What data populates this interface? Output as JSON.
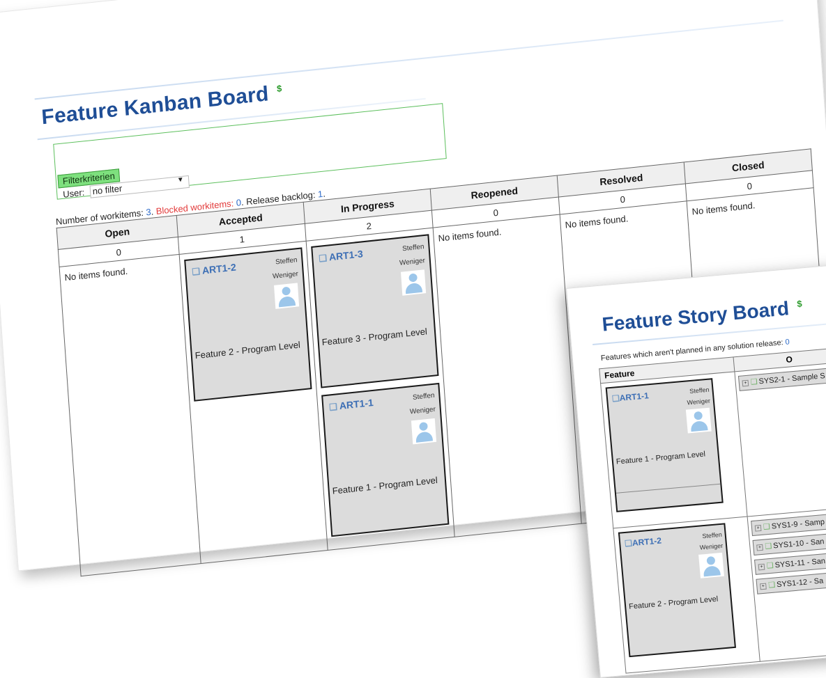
{
  "kanban": {
    "title": "Feature Kanban Board",
    "refresh_icon": "refresh-icon",
    "filter": {
      "legend": "Filterkriterien",
      "user_label": "User:",
      "user_value": "no filter"
    },
    "summary": {
      "workitems_label": "Number of workitems:",
      "workitems_count": "3",
      "blocked_label": "Blocked workitems:",
      "blocked_count": "0",
      "backlog_label": "Release backlog:",
      "backlog_count": "1"
    },
    "columns": [
      {
        "name": "Open",
        "count": "0",
        "empty_text": "No items found."
      },
      {
        "name": "Accepted",
        "count": "1"
      },
      {
        "name": "In Progress",
        "count": "2"
      },
      {
        "name": "Reopened",
        "count": "0",
        "empty_text": "No items found."
      },
      {
        "name": "Resolved",
        "count": "0",
        "empty_text": "No items found."
      },
      {
        "name": "Closed",
        "count": "0",
        "empty_text": "No items found."
      }
    ],
    "cards": [
      {
        "id": "ART1-2",
        "owner_first": "Steffen",
        "owner_last": "Weniger",
        "title": "Feature 2 - Program Level"
      },
      {
        "id": "ART1-3",
        "owner_first": "Steffen",
        "owner_last": "Weniger",
        "title": "Feature 3 - Program Level"
      },
      {
        "id": "ART1-1",
        "owner_first": "Steffen",
        "owner_last": "Weniger",
        "title": "Feature 1 - Program Level"
      }
    ]
  },
  "story": {
    "title": "Feature Story Board",
    "summary_label": "Features which aren't planned in any solution release:",
    "summary_count": "0",
    "feature_header": "Feature",
    "open_header": "O",
    "rows": [
      {
        "card": {
          "id": "ART1-1",
          "owner_first": "Steffen",
          "owner_last": "Weniger",
          "title": "Feature 1 - Program Level"
        },
        "stories": [
          "SYS2-1 - Sample S"
        ]
      },
      {
        "card": {
          "id": "ART1-2",
          "owner_first": "Steffen",
          "owner_last": "Weniger",
          "title": "Feature 2 - Program Level"
        },
        "stories": [
          "SYS1-9 - Samp",
          "SYS1-10 - San",
          "SYS1-11 - San",
          "SYS1-12 - Sa"
        ]
      }
    ]
  }
}
